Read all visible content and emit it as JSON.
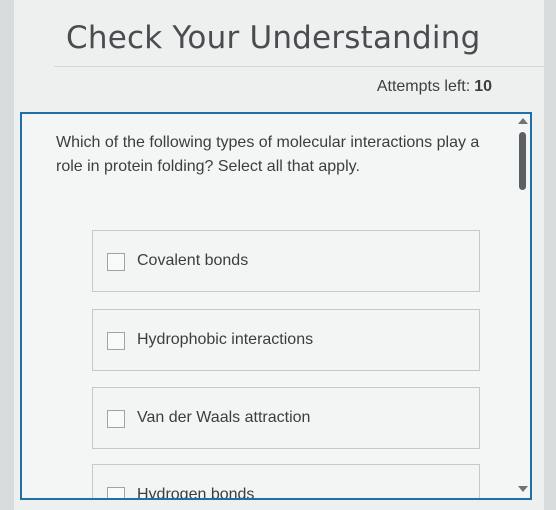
{
  "header": {
    "title": "Check Your Understanding",
    "attempts_label": "Attempts left:",
    "attempts_value": "10"
  },
  "question": {
    "text": "Which of the following types of molecular interactions play a role in protein folding? Select all that apply."
  },
  "options": [
    {
      "label": "Covalent bonds",
      "checked": false
    },
    {
      "label": "Hydrophobic interactions",
      "checked": false
    },
    {
      "label": "Van der Waals attraction",
      "checked": false
    },
    {
      "label": "Hydrogen bonds",
      "checked": false
    }
  ],
  "colors": {
    "accent_border": "#1f6fa8",
    "scroll_thumb": "#5b6063"
  }
}
